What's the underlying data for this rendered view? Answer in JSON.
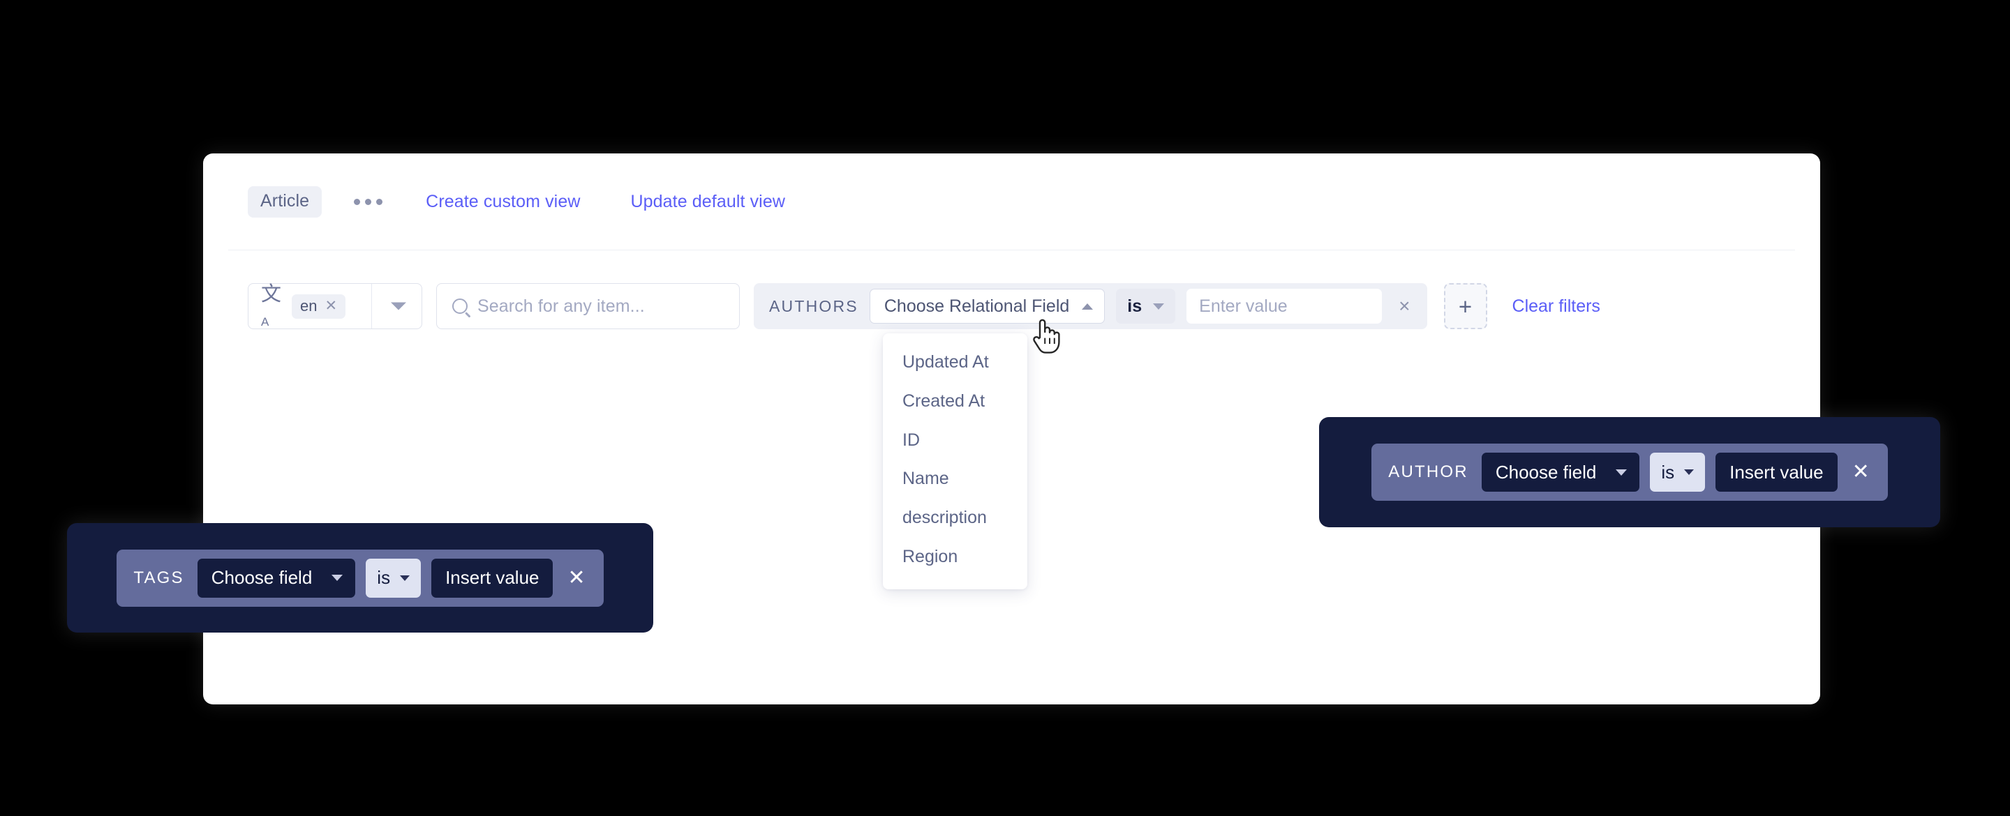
{
  "header": {
    "content_type_chip": "Article",
    "more_options_icon": "ellipsis-icon",
    "create_view_link": "Create custom view",
    "update_view_link": "Update default view"
  },
  "filter_bar": {
    "locale": {
      "icon": "translate-icon",
      "icon_glyph": "文",
      "icon_sub": "A",
      "selected_tag": "en",
      "remove_glyph": "✕",
      "caret_icon": "chevron-down-icon"
    },
    "search": {
      "icon": "search-icon",
      "placeholder": "Search for any item..."
    },
    "condition": {
      "label": "AUTHORS",
      "field_value": "Choose Relational Field",
      "field_caret_icon": "chevron-up-icon",
      "operator": "is",
      "operator_caret_icon": "chevron-down-icon",
      "value_placeholder": "Enter value",
      "remove_glyph": "×"
    },
    "add_filter_label": "+",
    "clear_filters_label": "Clear filters"
  },
  "dropdown": {
    "items": [
      "Updated At",
      "Created At",
      "ID",
      "Name",
      "description",
      "Region"
    ]
  },
  "panels": [
    {
      "id": "tags",
      "label": "TAGS",
      "field_value": "Choose field",
      "field_caret_icon": "chevron-down-icon",
      "operator": "is",
      "operator_caret_icon": "chevron-down-icon",
      "value": "Insert value",
      "remove_glyph": "✕"
    },
    {
      "id": "author",
      "label": "AUTHOR",
      "field_value": "Choose field",
      "field_caret_icon": "chevron-down-icon",
      "operator": "is",
      "operator_caret_icon": "chevron-down-icon",
      "value": "Insert value",
      "remove_glyph": "✕"
    }
  ],
  "colors": {
    "accent_link": "#5b5ef7",
    "panel_dark": "#141c3e",
    "panel_inner": "#646c9c",
    "chip_bg": "#eef0f6",
    "text_muted": "#5c6587",
    "placeholder": "#a3a9c2"
  }
}
